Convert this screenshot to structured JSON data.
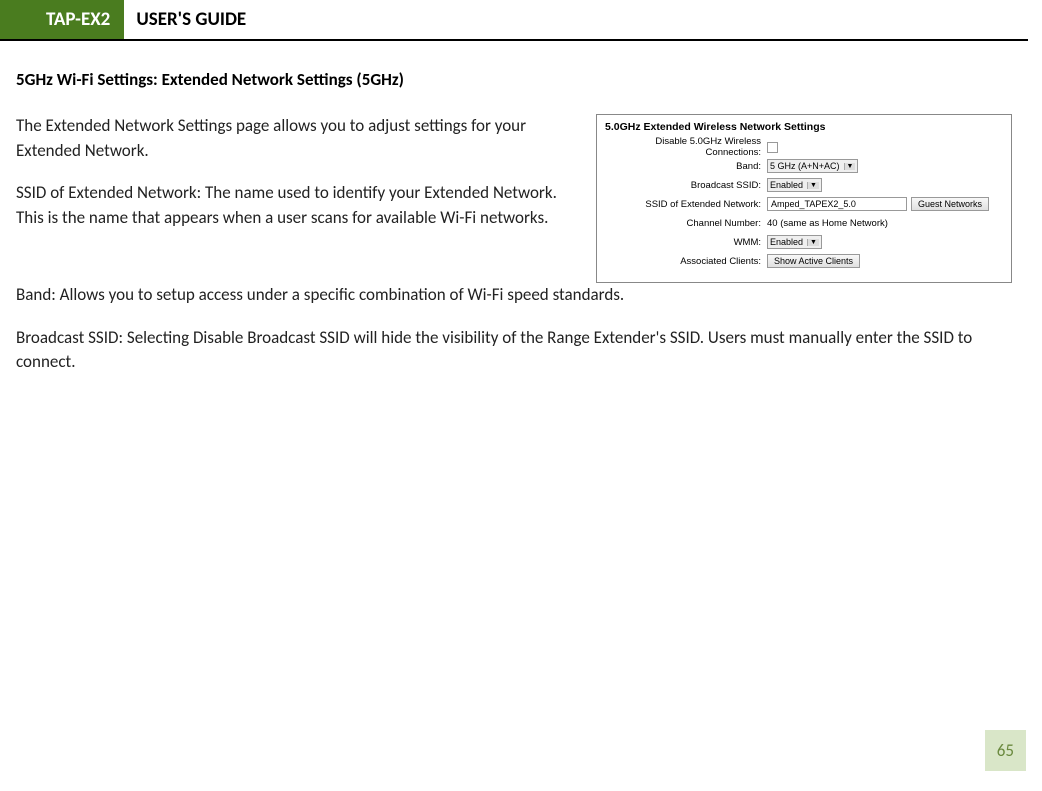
{
  "header": {
    "product": "TAP-EX2",
    "title": "USER'S GUIDE"
  },
  "section_heading": "5GHz Wi-Fi Settings: Extended Network Settings (5GHz)",
  "paragraphs": {
    "intro": "The Extended Network Settings page allows you to adjust settings for your Extended Network.",
    "ssid": "SSID of Extended Network: The name used to identify your Extended Network. This is the name that appears when a user scans for available Wi-Fi networks.",
    "band": "Band: Allows you to setup access under a specific combination of Wi-Fi speed standards.",
    "broadcast": "Broadcast SSID: Selecting Disable Broadcast SSID will hide the visibility of the Range Extender's SSID. Users must manually enter the SSID to connect."
  },
  "panel": {
    "title": "5.0GHz Extended Wireless Network Settings",
    "rows": {
      "disable_label": "Disable 5.0GHz Wireless Connections:",
      "band_label": "Band:",
      "band_value": "5 GHz (A+N+AC)",
      "broadcast_label": "Broadcast SSID:",
      "broadcast_value": "Enabled",
      "ssid_label": "SSID of Extended Network:",
      "ssid_value": "Amped_TAPEX2_5.0",
      "guest_btn": "Guest Networks",
      "channel_label": "Channel Number:",
      "channel_value": "40 (same as Home Network)",
      "wmm_label": "WMM:",
      "wmm_value": "Enabled",
      "clients_label": "Associated Clients:",
      "clients_btn": "Show Active Clients"
    }
  },
  "page_number": "65"
}
